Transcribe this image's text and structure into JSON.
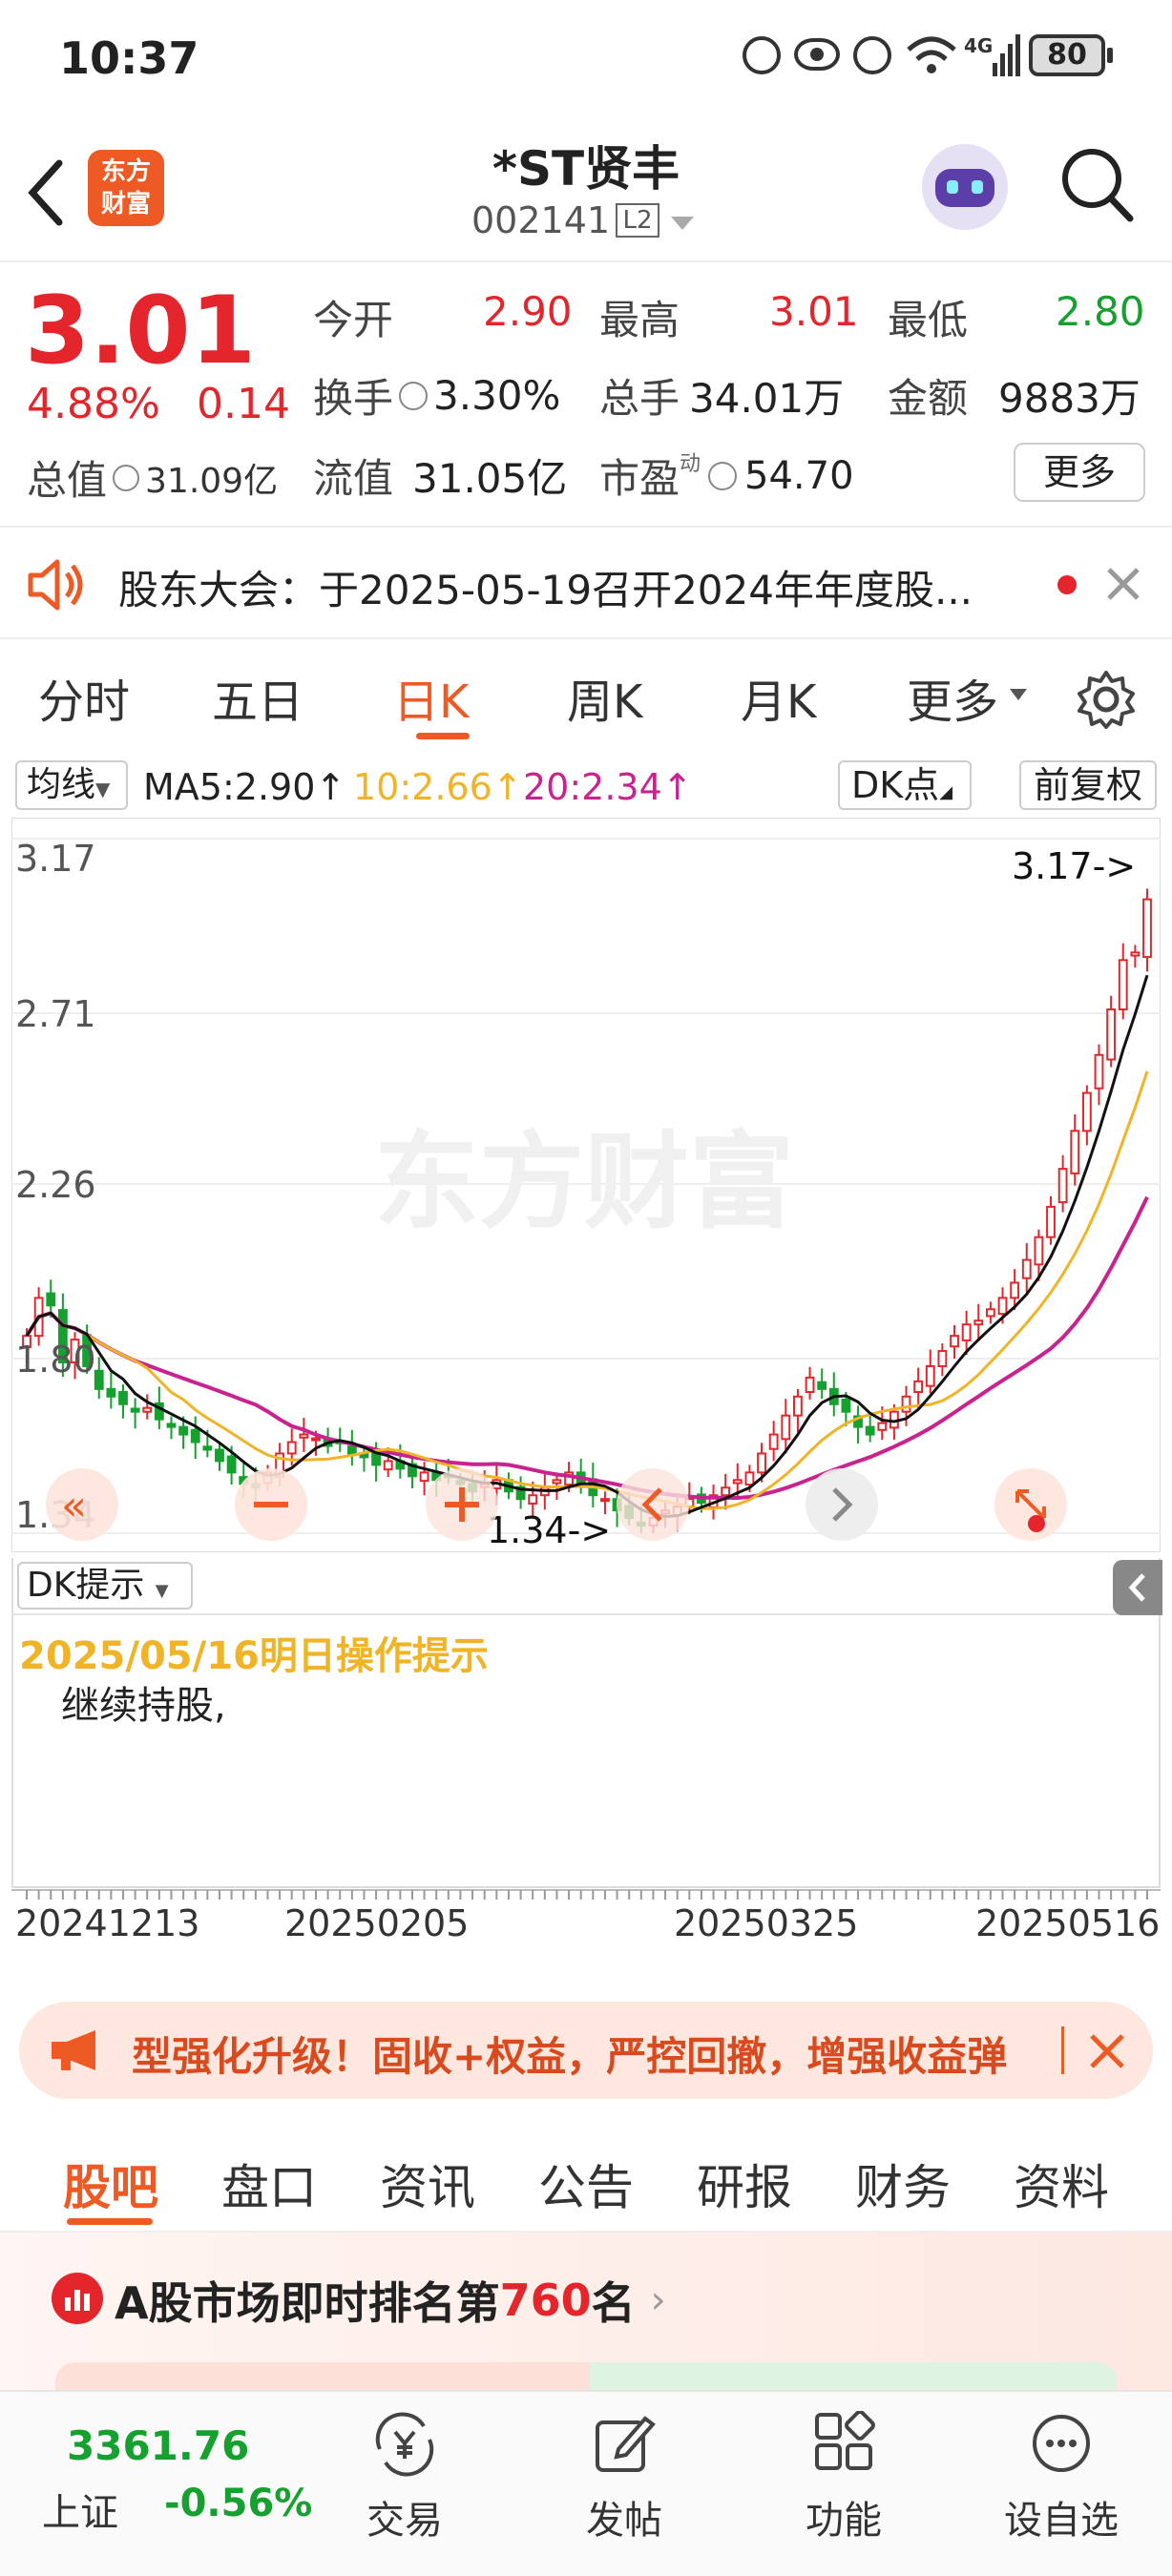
{
  "status_bar": {
    "time": "10:37",
    "network": "4G",
    "battery": "80"
  },
  "header": {
    "title": "*ST贤丰",
    "code": "002141",
    "level_badge": "L2",
    "brand_line1": "东方",
    "brand_line2": "财富"
  },
  "quote": {
    "price": "3.01",
    "change_pct": "4.88%",
    "change": "0.14",
    "open_label": "今开",
    "open": "2.90",
    "high_label": "最高",
    "high": "3.01",
    "low_label": "最低",
    "low": "2.80",
    "turnover_label": "换手",
    "turnover": "3.30%",
    "volume_label": "总手",
    "volume": "34.01万",
    "amount_label": "金额",
    "amount": "9883万",
    "mktcap_label": "总值",
    "mktcap": "31.09亿",
    "float_label": "流值",
    "float_cap": "31.05亿",
    "pe_label": "市盈",
    "pe_superscript": "动",
    "pe": "54.70",
    "more_label": "更多"
  },
  "notice": {
    "text": "股东大会：于2025-05-19召开2024年年度股..."
  },
  "period_tabs": [
    "分时",
    "五日",
    "日K",
    "周K",
    "月K",
    "更多"
  ],
  "active_period": "日K",
  "chart_toolbar": {
    "ma_select": "均线",
    "ma5": "MA5:2.90↑",
    "ma10": "10:2.66↑",
    "ma20": "20:2.34↑",
    "dk_select": "DK点",
    "adjust": "前复权"
  },
  "chart_data": {
    "type": "candlestick",
    "y_ticks": [
      "3.17",
      "2.71",
      "2.26",
      "1.80",
      "1.34"
    ],
    "ylim": [
      1.34,
      3.17
    ],
    "x_ticks": [
      "20241213",
      "20250205",
      "20250325",
      "20250516"
    ],
    "max_marker": "3.17->",
    "min_marker": "1.34->",
    "watermark": "东方财富",
    "colors": {
      "up": "#e4262c",
      "down": "#16a030",
      "ma5": "#111111",
      "ma10": "#f0b429",
      "ma20": "#c8238f"
    },
    "closes": [
      1.86,
      1.96,
      1.94,
      1.79,
      1.85,
      1.78,
      1.72,
      1.7,
      1.68,
      1.66,
      1.67,
      1.64,
      1.62,
      1.6,
      1.58,
      1.56,
      1.53,
      1.5,
      1.47,
      1.46,
      1.5,
      1.55,
      1.58,
      1.6,
      1.59,
      1.57,
      1.58,
      1.55,
      1.54,
      1.52,
      1.53,
      1.51,
      1.49,
      1.5,
      1.48,
      1.49,
      1.47,
      1.45,
      1.47,
      1.48,
      1.45,
      1.43,
      1.44,
      1.46,
      1.48,
      1.5,
      1.47,
      1.44,
      1.43,
      1.4,
      1.38,
      1.36,
      1.38,
      1.4,
      1.41,
      1.43,
      1.42,
      1.44,
      1.46,
      1.48,
      1.5,
      1.55,
      1.6,
      1.65,
      1.7,
      1.75,
      1.72,
      1.68,
      1.66,
      1.62,
      1.6,
      1.63,
      1.66,
      1.7,
      1.74,
      1.78,
      1.82,
      1.86,
      1.89,
      1.9,
      1.93,
      1.96,
      2.0,
      2.06,
      2.12,
      2.2,
      2.3,
      2.4,
      2.5,
      2.6,
      2.72,
      2.85,
      2.87,
      3.01
    ]
  },
  "dk": {
    "select": "DK提示",
    "date_tip": "2025/05/16明日操作提示",
    "advice": "继续持股,"
  },
  "banner": {
    "text": "型强化升级！固收+权益，严控回撤，增强收益弹"
  },
  "bottom_tabs": [
    "股吧",
    "盘口",
    "资讯",
    "公告",
    "研报",
    "财务",
    "资料"
  ],
  "active_bottom_tab": "股吧",
  "ranking": {
    "prefix": "A股市场即时排名第",
    "rank": "760",
    "suffix": "名"
  },
  "dock": {
    "index_value": "3361.76",
    "index_name": "上证",
    "index_change": "-0.56%",
    "items": [
      "交易",
      "发帖",
      "功能",
      "设自选"
    ]
  }
}
